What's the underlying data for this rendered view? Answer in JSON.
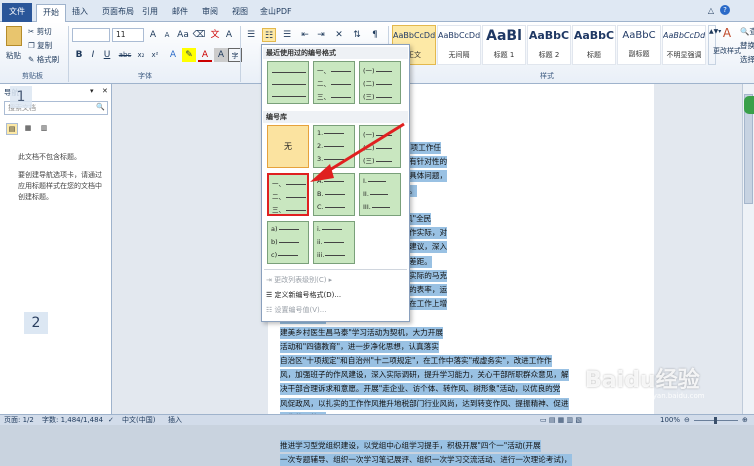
{
  "tabs": [
    "文件",
    "开始",
    "插入",
    "页面布局",
    "引用",
    "邮件",
    "审阅",
    "视图",
    "金山PDF"
  ],
  "clipboard": {
    "paste": "粘贴",
    "cut": "剪切",
    "copy": "复制",
    "format_painter": "格式刷",
    "label": "剪贴板"
  },
  "font": {
    "name": "",
    "size": "11",
    "label": "字体",
    "bold": "B",
    "italic": "I",
    "underline": "U",
    "strike": "abc",
    "sub": "x₂",
    "sup": "x²",
    "grow": "A",
    "shrink": "A",
    "color": "A"
  },
  "styles": {
    "label": "样式",
    "items": [
      {
        "preview": "AaBbCcDd",
        "name": "正文"
      },
      {
        "preview": "AaBbCcDd",
        "name": "无间隔"
      },
      {
        "preview": "AaBl",
        "name": "标题 1"
      },
      {
        "preview": "AaBbC",
        "name": "标题 2"
      },
      {
        "preview": "AaBbC",
        "name": "标题"
      },
      {
        "preview": "AaBbC",
        "name": "副标题"
      },
      {
        "preview": "AaBbCcDd",
        "name": "不明显强调"
      }
    ],
    "change": "更改样式"
  },
  "editing": {
    "find": "查找",
    "replace": "替换",
    "select": "选择"
  },
  "nav": {
    "title": "导航",
    "search_placeholder": "搜索文档",
    "message1": "此文档不包含标题。",
    "message2": "要创建导航选项卡，请通过应用标题样式在您的文档中创建标题。"
  },
  "annotations": {
    "one": "1",
    "two": "2"
  },
  "menu": {
    "recent_header": "最近使用过的编号格式",
    "library_header": "编号库",
    "none_label": "无",
    "actions": [
      "更改列表级别(C)",
      "定义新编号格式(D)...",
      "设置编号值(V)..."
    ],
    "formats": {
      "dunhao": [
        "一、",
        "二、",
        "三、"
      ],
      "paren_cn": [
        "(一)",
        "(二)",
        "(三)"
      ],
      "arabic": [
        "1.",
        "2.",
        "3."
      ],
      "roman": [
        "I.",
        "II.",
        "III."
      ],
      "upper": [
        "A.",
        "B.",
        "C."
      ],
      "lower_paren": [
        "a)",
        "b)",
        "c)"
      ],
      "lower_roman": [
        "i.",
        "ii.",
        "iii."
      ]
    }
  },
  "doc": {
    "lines": [
      {
        "t": "戒虚务实\"为指导, 全面落实 20xx 年各项工作任",
        "hl": true
      },
      {
        "t": "工作运行机制，一切从干部需求出发，有针对性的",
        "hl": true
      },
      {
        "t": "想交流的平台，清楚和前关干部关切的具体问题，",
        "hl": true
      },
      {
        "t": "，为各项工作开展提供思想和组织保证。",
        "hl": true
      },
      {
        "t": "",
        "hl": false
      },
      {
        "t": "委开展的\"迎庆十八大，讲文明，树新风\"全民",
        "hl": true
      },
      {
        "t": "文明素质方面的教育。紧密结合税收工作实际，对",
        "hl": true
      },
      {
        "t": "化座谈活动，对党员、群众提出的意见建议，深入",
        "hl": true
      },
      {
        "t": "思路、新理念、新举措对照实际工作找差距。",
        "hl": true
      },
      {
        "t": "实践活动，增效创优。要发挥理论联系实际的马克",
        "hl": true
      },
      {
        "t": "用，争做学习、传达、运用十八大精神的表率，运",
        "hl": true
      },
      {
        "t": "的建强坚定性，在行动上增强自觉性，在工作上增",
        "hl": true
      },
      {
        "t": "动工作开展。",
        "hl": true
      },
      {
        "t": "建美乡村医生昌马泰\"学习活动为契机，大力开展",
        "hl": true
      },
      {
        "t": "活动和\"四德教育\"，进一步净化思想，认真落实",
        "hl": true
      },
      {
        "t": "自治区\"十项规定\"和自治州\"十二项规定\"，在工作中落实\"戒虚务实\"，改进工作作",
        "hl": true
      },
      {
        "t": "风，加强班子的作风建设，深入实际调研，提升学习能力，关心干部所职群众意见，解",
        "hl": true
      },
      {
        "t": "决干部合理诉求和意愿。开展\"走企业、访个体、转作风、树形象\"活动，以优良的党",
        "hl": true
      },
      {
        "t": "风促政风，以扎实的工作作风推升地税部门行业风尚，达到转变作风、提振精神、促进",
        "hl": true
      },
      {
        "t": "工作的目的。",
        "hl": true
      },
      {
        "t": "",
        "hl": false
      },
      {
        "t": "推进学习型党组织建设，以党组中心组学习提手，积极开展\"四个一\"活动(开展",
        "hl": true
      },
      {
        "t": "一次专题辅导、组织一次学习笔记展评、组织一次学习交流活动、进行一次理论考试)，",
        "hl": true
      }
    ]
  },
  "status": {
    "page": "页面: 1/2",
    "words": "字数: 1,484/1,484",
    "lang": "中文(中国)",
    "mode": "插入",
    "zoom": "100%"
  },
  "watermark": "Baidu经验",
  "watermark_sub": "jingyan.baidu.com"
}
